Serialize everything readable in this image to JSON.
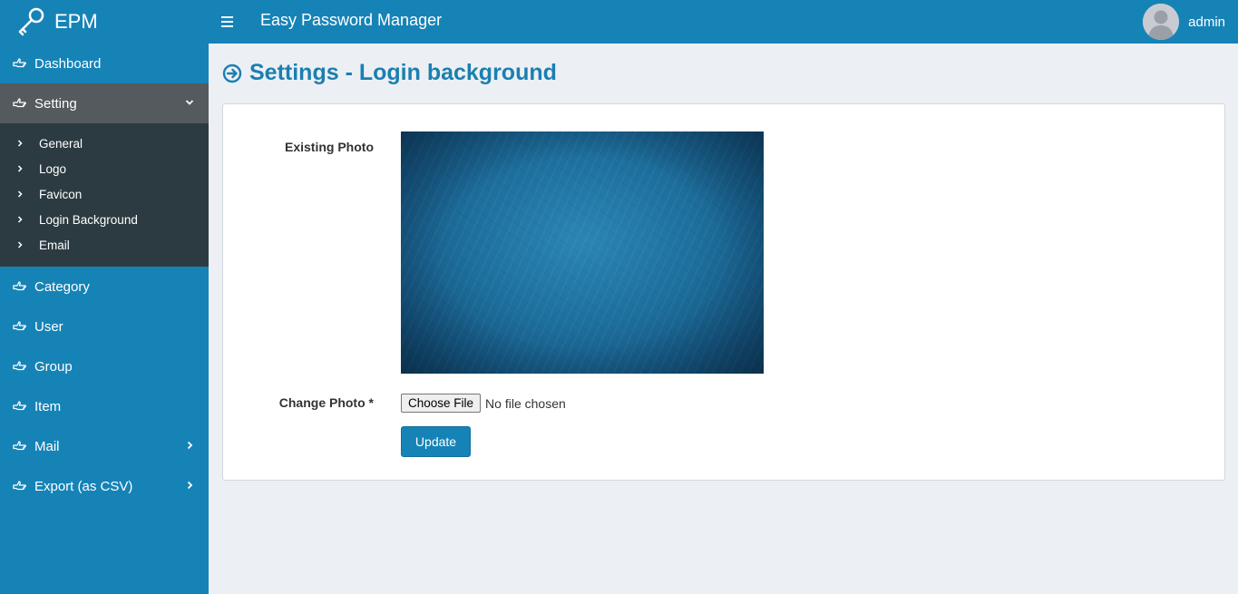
{
  "brand": {
    "logo_text": "EPM",
    "app_title": "Easy Password Manager"
  },
  "user": {
    "name": "admin"
  },
  "sidebar": {
    "items": [
      {
        "label": "Dashboard",
        "icon": "hand-point-right-icon"
      },
      {
        "label": "Setting",
        "icon": "hand-point-right-icon",
        "expanded": true,
        "children": [
          "General",
          "Logo",
          "Favicon",
          "Login Background",
          "Email"
        ]
      },
      {
        "label": "Category",
        "icon": "hand-point-right-icon"
      },
      {
        "label": "User",
        "icon": "hand-point-right-icon"
      },
      {
        "label": "Group",
        "icon": "hand-point-right-icon"
      },
      {
        "label": "Item",
        "icon": "hand-point-right-icon"
      },
      {
        "label": "Mail",
        "icon": "hand-point-right-icon",
        "has_children": true
      },
      {
        "label": "Export (as CSV)",
        "icon": "hand-point-right-icon",
        "has_children": true
      }
    ]
  },
  "page": {
    "title": "Settings - Login background",
    "title_icon": "circle-arrow-right-icon"
  },
  "form": {
    "existing_photo_label": "Existing Photo",
    "change_photo_label": "Change Photo *",
    "file_button_label": "Choose File",
    "file_status": "No file chosen",
    "submit_label": "Update"
  },
  "colors": {
    "primary": "#1683b7",
    "sidebar_active": "#555a5e",
    "submenu_bg": "#2c3b41",
    "content_bg": "#ecf0f5",
    "title": "#1b7fb0"
  }
}
